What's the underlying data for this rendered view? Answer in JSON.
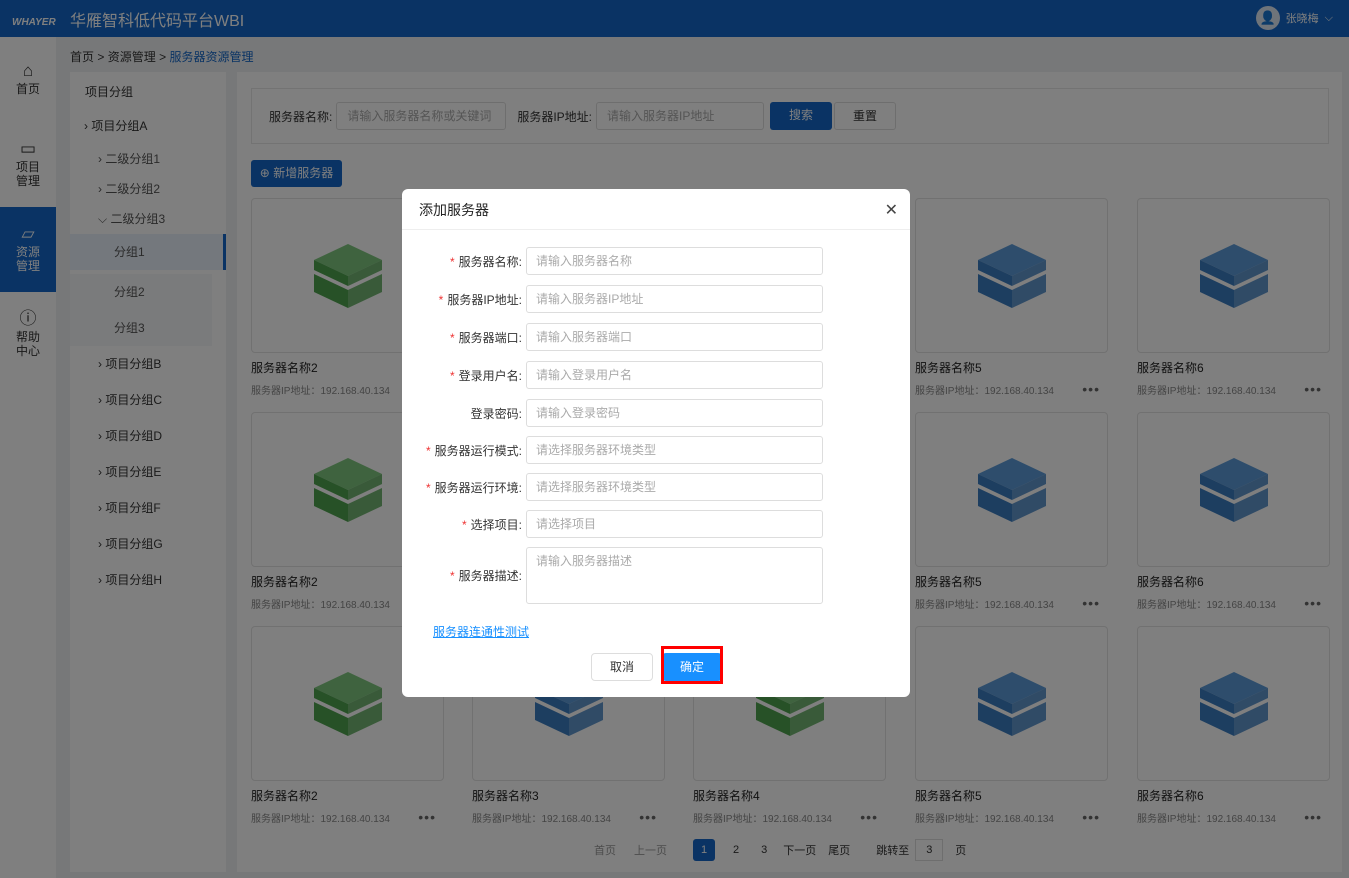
{
  "header": {
    "logo": "WHAYER",
    "title": "华雁智科低代码平台WBI",
    "user": "张晓梅"
  },
  "nav": [
    {
      "label": "首页",
      "icon": "home-icon"
    },
    {
      "label": "项目管理",
      "icon": "monitor-icon"
    },
    {
      "label": "资源管理",
      "icon": "folder-icon",
      "active": true
    },
    {
      "label": "帮助中心",
      "icon": "help-icon"
    }
  ],
  "breadcrumb": {
    "home": "首页",
    "sep": ">",
    "parent": "资源管理",
    "current": "服务器资源管理"
  },
  "tree": {
    "title": "项目分组",
    "groupA": "项目分组A",
    "sub1": "二级分组1",
    "sub2": "二级分组2",
    "sub3": "二级分组3",
    "leaf1": "分组1",
    "leaf2": "分组2",
    "leaf3": "分组3",
    "others": [
      "项目分组B",
      "项目分组C",
      "项目分组D",
      "项目分组E",
      "项目分组F",
      "项目分组G",
      "项目分组H"
    ]
  },
  "search": {
    "name_label": "服务器名称:",
    "name_placeholder": "请输入服务器名称或关键词",
    "ip_label": "服务器IP地址:",
    "ip_placeholder": "请输入服务器IP地址",
    "search": "搜索",
    "reset": "重置"
  },
  "add_button": "新增服务器",
  "cards": {
    "names": [
      "服务器名称2",
      "服务器名称3",
      "服务器名称4",
      "服务器名称5",
      "服务器名称6"
    ],
    "colors": [
      "green",
      "blue",
      "green",
      "blue",
      "blue"
    ],
    "ip": "服务器IP地址：192.168.40.134",
    "more": "•••"
  },
  "pager": {
    "first": "首页",
    "prev": "上一页",
    "pages": [
      "1",
      "2",
      "3"
    ],
    "current": "1",
    "next": "下一页",
    "last": "尾页",
    "jump": "跳转至",
    "jump_value": "3",
    "page": "页"
  },
  "modal": {
    "title": "添加服务器",
    "fields": [
      {
        "label": "服务器名称:",
        "placeholder": "请输入服务器名称",
        "required": true
      },
      {
        "label": "服务器IP地址:",
        "placeholder": "请输入服务器IP地址",
        "required": true
      },
      {
        "label": "服务器端口:",
        "placeholder": "请输入服务器端口",
        "required": true
      },
      {
        "label": "登录用户名:",
        "placeholder": "请输入登录用户名",
        "required": true
      },
      {
        "label": "登录密码:",
        "placeholder": "请输入登录密码",
        "required": false
      },
      {
        "label": "服务器运行模式:",
        "placeholder": "请选择服务器环境类型",
        "required": true
      },
      {
        "label": "服务器运行环境:",
        "placeholder": "请选择服务器环境类型",
        "required": true
      },
      {
        "label": "选择项目:",
        "placeholder": "请选择项目",
        "required": true
      },
      {
        "label": "服务器描述:",
        "placeholder": "请输入服务器描述",
        "required": true
      }
    ],
    "test_link": "服务器连通性测试",
    "cancel": "取消",
    "ok": "确定"
  },
  "colors": {
    "primary": "#1467c8",
    "link": "#1890ff",
    "highlight": "#ff0000"
  }
}
